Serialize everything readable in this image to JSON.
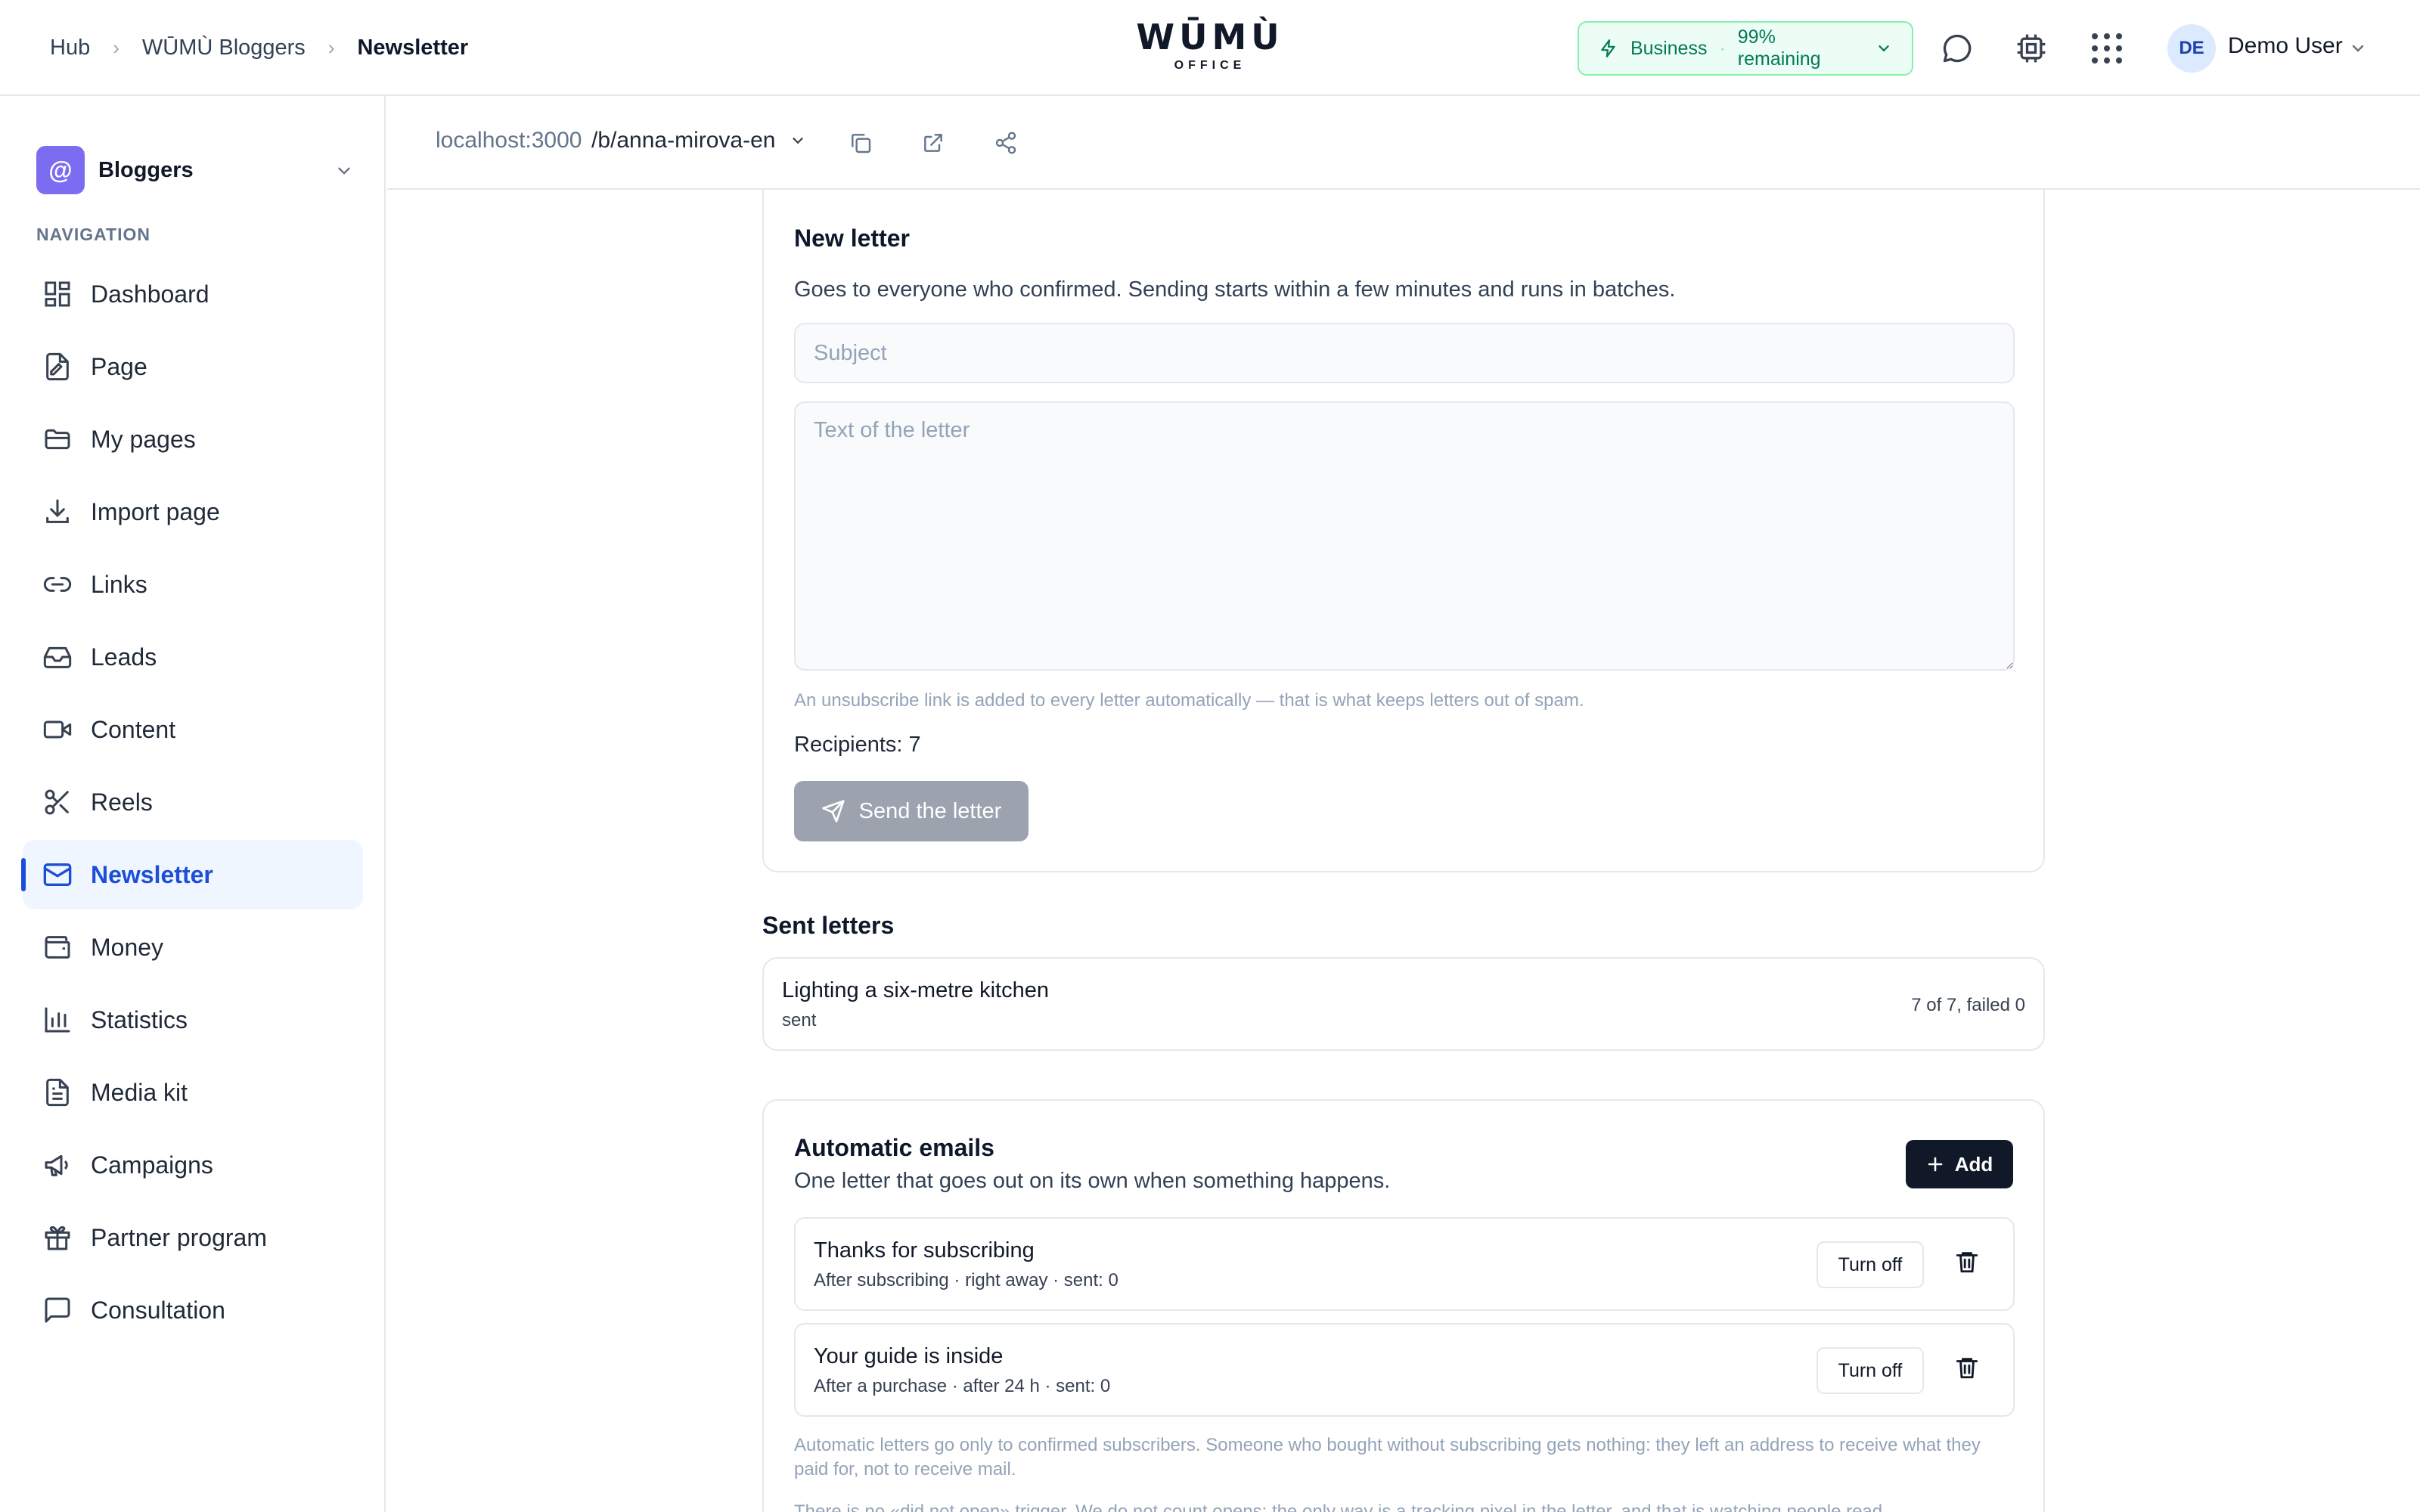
{
  "header": {
    "breadcrumbs": [
      "Hub",
      "WŪMÙ Bloggers",
      "Newsletter"
    ],
    "logo_main": "WŪMÙ",
    "logo_sub": "OFFICE",
    "plan": {
      "name": "Business",
      "separator": "·",
      "remaining": "99% remaining"
    },
    "user": {
      "initials": "DE",
      "name": "Demo User"
    }
  },
  "sidebar": {
    "workspace": {
      "badge": "@",
      "name": "Bloggers"
    },
    "heading": "NAVIGATION",
    "items": [
      {
        "label": "Dashboard",
        "icon": "dashboard-icon"
      },
      {
        "label": "Page",
        "icon": "page-icon"
      },
      {
        "label": "My pages",
        "icon": "folder-icon"
      },
      {
        "label": "Import page",
        "icon": "download-icon"
      },
      {
        "label": "Links",
        "icon": "link-icon"
      },
      {
        "label": "Leads",
        "icon": "inbox-icon"
      },
      {
        "label": "Content",
        "icon": "video-icon"
      },
      {
        "label": "Reels",
        "icon": "scissors-icon"
      },
      {
        "label": "Newsletter",
        "icon": "mail-icon"
      },
      {
        "label": "Money",
        "icon": "wallet-icon"
      },
      {
        "label": "Statistics",
        "icon": "bar-chart-icon"
      },
      {
        "label": "Media kit",
        "icon": "document-icon"
      },
      {
        "label": "Campaigns",
        "icon": "megaphone-icon"
      },
      {
        "label": "Partner program",
        "icon": "gift-icon"
      },
      {
        "label": "Consultation",
        "icon": "chat-icon"
      }
    ],
    "active": "Newsletter"
  },
  "urlbar": {
    "host": "localhost:3000",
    "path": "/b/anna-mirova-en"
  },
  "new_letter": {
    "title": "New letter",
    "description": "Goes to everyone who confirmed. Sending starts within a few minutes and runs in batches.",
    "subject_placeholder": "Subject",
    "text_placeholder": "Text of the letter",
    "hint": "An unsubscribe link is added to every letter automatically — that is what keeps letters out of spam.",
    "recipients": "Recipients: 7",
    "send_label": "Send the letter"
  },
  "sent_letters": {
    "title": "Sent letters",
    "items": [
      {
        "title": "Lighting a six-metre kitchen",
        "status": "sent",
        "stats": "7 of 7, failed 0"
      }
    ]
  },
  "automatic": {
    "title": "Automatic emails",
    "description": "One letter that goes out on its own when something happens.",
    "add_label": "Add",
    "items": [
      {
        "title": "Thanks for subscribing",
        "meta": "After subscribing · right away · sent: 0",
        "toggle": "Turn off"
      },
      {
        "title": "Your guide is inside",
        "meta": "After a purchase · after 24 h · sent: 0",
        "toggle": "Turn off"
      }
    ],
    "note_1": "Automatic letters go only to confirmed subscribers. Someone who bought without subscribing gets nothing: they left an address to receive what they paid for, not to receive mail.",
    "note_2": "There is no «did not open» trigger. We do not count opens: the only way is a tracking pixel in the letter, and that is watching people read."
  }
}
